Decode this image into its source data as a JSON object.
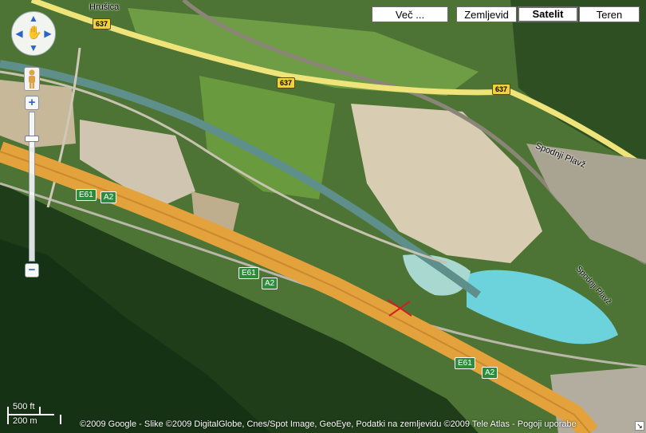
{
  "map_type_buttons": {
    "more": "Več ...",
    "map": "Zemljevid",
    "satellite": "Satelit",
    "terrain": "Teren",
    "active": "satellite"
  },
  "place_labels": {
    "hrusica": "Hrušica",
    "spodnji_plavz_1": "Spodnji Plavž",
    "spodnji_plavz_2": "Spodnji Plavž"
  },
  "road_shields": {
    "r637_a": "637",
    "r637_b": "637",
    "r637_c": "637",
    "e61_a": "E61",
    "a2_a": "A2",
    "e61_b": "E61",
    "a2_b": "A2",
    "e61_c": "E61",
    "a2_c": "A2"
  },
  "scale": {
    "imperial": "500 ft",
    "metric": "200 m"
  },
  "copyright": "©2009 Google - Slike ©2009 DigitalGlobe, Cnes/Spot Image, GeoEye, Podatki na zemljevidu ©2009 Tele Atlas - Pogoji uporabe",
  "colors": {
    "forest": "#23421c",
    "lake": "#6cd2dc",
    "motorway": "#e3a23c",
    "regional_road": "#eee47a",
    "quarry": "#d9cdb4",
    "field": "#5c8a3a"
  }
}
